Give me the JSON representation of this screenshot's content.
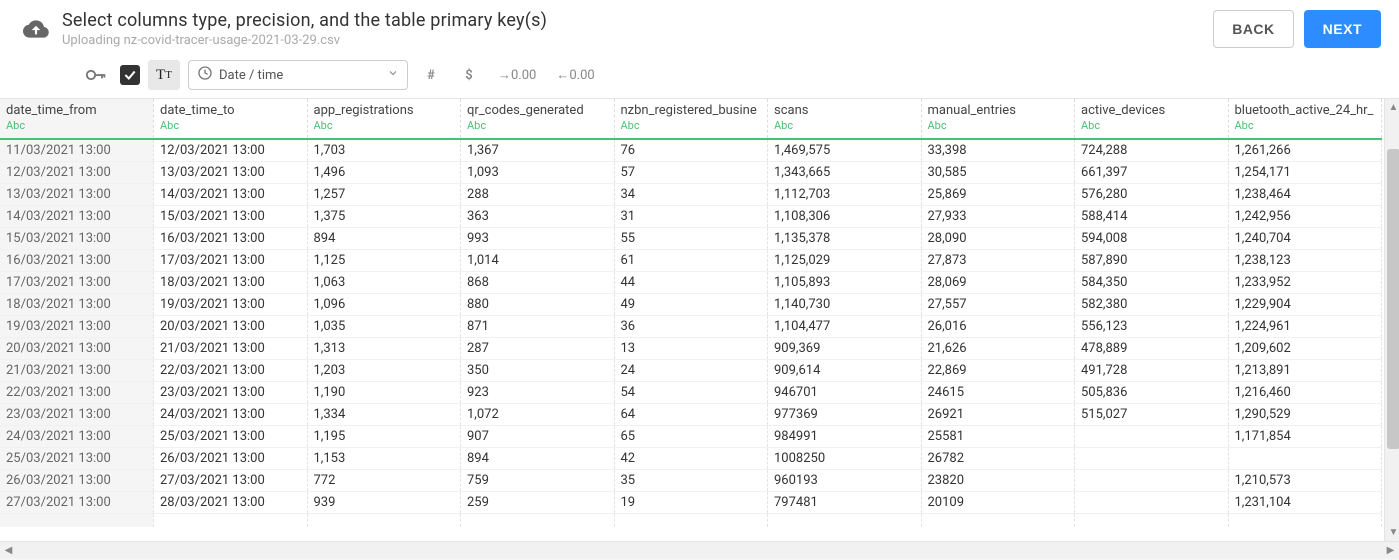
{
  "header": {
    "title": "Select columns type, precision, and the table primary key(s)",
    "subtitle": "Uploading nz-covid-tracer-usage-2021-03-29.csv",
    "back_label": "BACK",
    "next_label": "NEXT"
  },
  "toolbar": {
    "type_dropdown_label": "Date / time",
    "dec_increase": "→0.00",
    "dec_decrease": "←0.00",
    "hash": "#",
    "dollar": "$"
  },
  "columns": [
    {
      "name": "date_time_from",
      "type": "Abc",
      "locked": true
    },
    {
      "name": "date_time_to",
      "type": "Abc",
      "locked": false
    },
    {
      "name": "app_registrations",
      "type": "Abc",
      "locked": false
    },
    {
      "name": "qr_codes_generated",
      "type": "Abc",
      "locked": false
    },
    {
      "name": "nzbn_registered_busine",
      "type": "Abc",
      "locked": false
    },
    {
      "name": "scans",
      "type": "Abc",
      "locked": false
    },
    {
      "name": "manual_entries",
      "type": "Abc",
      "locked": false
    },
    {
      "name": "active_devices",
      "type": "Abc",
      "locked": false
    },
    {
      "name": "bluetooth_active_24_hr_",
      "type": "Abc",
      "locked": false
    }
  ],
  "rows": [
    [
      "11/03/2021 13:00",
      "12/03/2021 13:00",
      "1,703",
      "1,367",
      "76",
      "1,469,575",
      "33,398",
      "724,288",
      "1,261,266"
    ],
    [
      "12/03/2021 13:00",
      "13/03/2021 13:00",
      "1,496",
      "1,093",
      "57",
      "1,343,665",
      "30,585",
      "661,397",
      "1,254,171"
    ],
    [
      "13/03/2021 13:00",
      "14/03/2021 13:00",
      "1,257",
      "288",
      "34",
      "1,112,703",
      "25,869",
      "576,280",
      "1,238,464"
    ],
    [
      "14/03/2021 13:00",
      "15/03/2021 13:00",
      "1,375",
      "363",
      "31",
      "1,108,306",
      "27,933",
      "588,414",
      "1,242,956"
    ],
    [
      "15/03/2021 13:00",
      "16/03/2021 13:00",
      "894",
      "993",
      "55",
      "1,135,378",
      "28,090",
      "594,008",
      "1,240,704"
    ],
    [
      "16/03/2021 13:00",
      "17/03/2021 13:00",
      "1,125",
      "1,014",
      "61",
      "1,125,029",
      "27,873",
      "587,890",
      "1,238,123"
    ],
    [
      "17/03/2021 13:00",
      "18/03/2021 13:00",
      "1,063",
      "868",
      "44",
      "1,105,893",
      "28,069",
      "584,350",
      "1,233,952"
    ],
    [
      "18/03/2021 13:00",
      "19/03/2021 13:00",
      "1,096",
      "880",
      "49",
      "1,140,730",
      "27,557",
      "582,380",
      "1,229,904"
    ],
    [
      "19/03/2021 13:00",
      "20/03/2021 13:00",
      "1,035",
      "871",
      "36",
      "1,104,477",
      "26,016",
      "556,123",
      "1,224,961"
    ],
    [
      "20/03/2021 13:00",
      "21/03/2021 13:00",
      "1,313",
      "287",
      "13",
      "909,369",
      "21,626",
      "478,889",
      "1,209,602"
    ],
    [
      "21/03/2021 13:00",
      "22/03/2021 13:00",
      "1,203",
      "350",
      "24",
      "909,614",
      "22,869",
      "491,728",
      "1,213,891"
    ],
    [
      "22/03/2021 13:00",
      "23/03/2021 13:00",
      "1,190",
      "923",
      "54",
      "946701",
      "24615",
      "505,836",
      "1,216,460"
    ],
    [
      "23/03/2021 13:00",
      "24/03/2021 13:00",
      "1,334",
      "1,072",
      "64",
      "977369",
      "26921",
      "515,027",
      "1,290,529"
    ],
    [
      "24/03/2021 13:00",
      "25/03/2021 13:00",
      "1,195",
      "907",
      "65",
      "984991",
      "25581",
      "",
      "1,171,854"
    ],
    [
      "25/03/2021 13:00",
      "26/03/2021 13:00",
      "1,153",
      "894",
      "42",
      "1008250",
      "26782",
      "",
      ""
    ],
    [
      "26/03/2021 13:00",
      "27/03/2021 13:00",
      "772",
      "759",
      "35",
      "960193",
      "23820",
      "",
      "1,210,573"
    ],
    [
      "27/03/2021 13:00",
      "28/03/2021 13:00",
      "939",
      "259",
      "19",
      "797481",
      "20109",
      "",
      "1,231,104"
    ]
  ]
}
